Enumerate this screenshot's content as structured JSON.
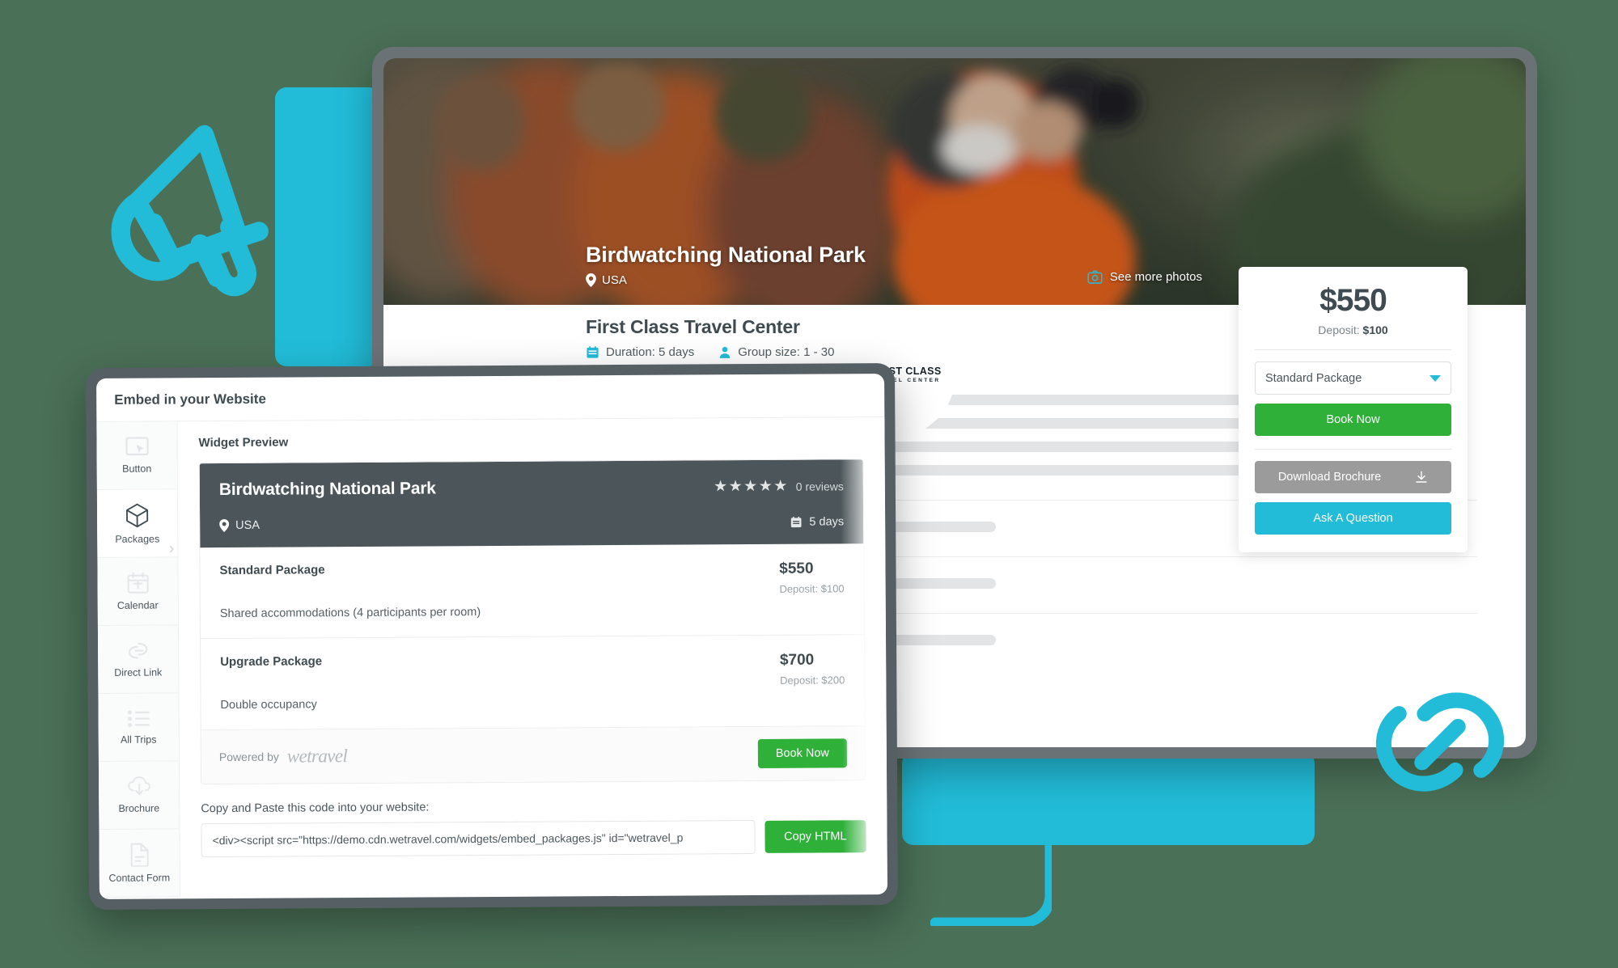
{
  "hero": {
    "trip_title": "Birdwatching National Park",
    "location": "USA",
    "see_more_photos": "See more photos",
    "location_icon": "map-pin-icon",
    "camera_icon": "camera-icon"
  },
  "company": {
    "name": "First Class Travel Center",
    "duration": "Duration: 5 days",
    "group_size": "Group size: 1 - 30",
    "calendar_icon": "calendar-icon",
    "person_icon": "person-icon",
    "logo_line1": "FIRST CLASS",
    "logo_line2": "TRAVEL CENTER"
  },
  "booking": {
    "price": "$550",
    "deposit_label": "Deposit:",
    "deposit_value": "$100",
    "package_selected": "Standard Package",
    "book_now": "Book Now",
    "download_brochure": "Download Brochure",
    "ask_question": "Ask A Question",
    "download_icon": "download-icon",
    "chevron_down_icon": "chevron-down-icon"
  },
  "modal": {
    "title": "Embed in your Website",
    "sidebar": [
      {
        "label": "Button",
        "icon": "cursor-click-icon",
        "active": false
      },
      {
        "label": "Packages",
        "icon": "package-cube-icon",
        "active": true
      },
      {
        "label": "Calendar",
        "icon": "calendar-icon",
        "active": false
      },
      {
        "label": "Direct Link",
        "icon": "link-icon",
        "active": false
      },
      {
        "label": "All Trips",
        "icon": "list-icon",
        "active": false
      },
      {
        "label": "Brochure",
        "icon": "cloud-download-icon",
        "active": false
      },
      {
        "label": "Contact Form",
        "icon": "document-icon",
        "active": false
      }
    ],
    "preview_heading": "Widget Preview",
    "widget": {
      "title": "Birdwatching National Park",
      "stars": "★★★★★",
      "reviews": "0 reviews",
      "location": "USA",
      "duration": "5 days",
      "location_icon": "map-pin-icon",
      "calendar_icon": "calendar-icon",
      "packages": [
        {
          "name": "Standard Package",
          "price": "$550",
          "deposit": "Deposit: $100",
          "description": "Shared accommodations (4 participants per room)"
        },
        {
          "name": "Upgrade Package",
          "price": "$700",
          "deposit": "Deposit: $200",
          "description": "Double occupancy"
        }
      ],
      "powered_by": "Powered by",
      "brand": "wetravel",
      "book_now": "Book Now"
    },
    "copy_label": "Copy and Paste this code into your website:",
    "embed_code": "<div><script src=\"https://demo.cdn.wetravel.com/widgets/embed_packages.js\" id=\"wetravel_p",
    "copy_button": "Copy HTML"
  },
  "decorations": {
    "megaphone_icon": "megaphone-icon",
    "link_icon": "link-chain-icon",
    "accent_cyan": "#22bcd8",
    "accent_green": "#2eb039",
    "background_green": "#4a7057",
    "dark_panel": "#4c5559"
  }
}
